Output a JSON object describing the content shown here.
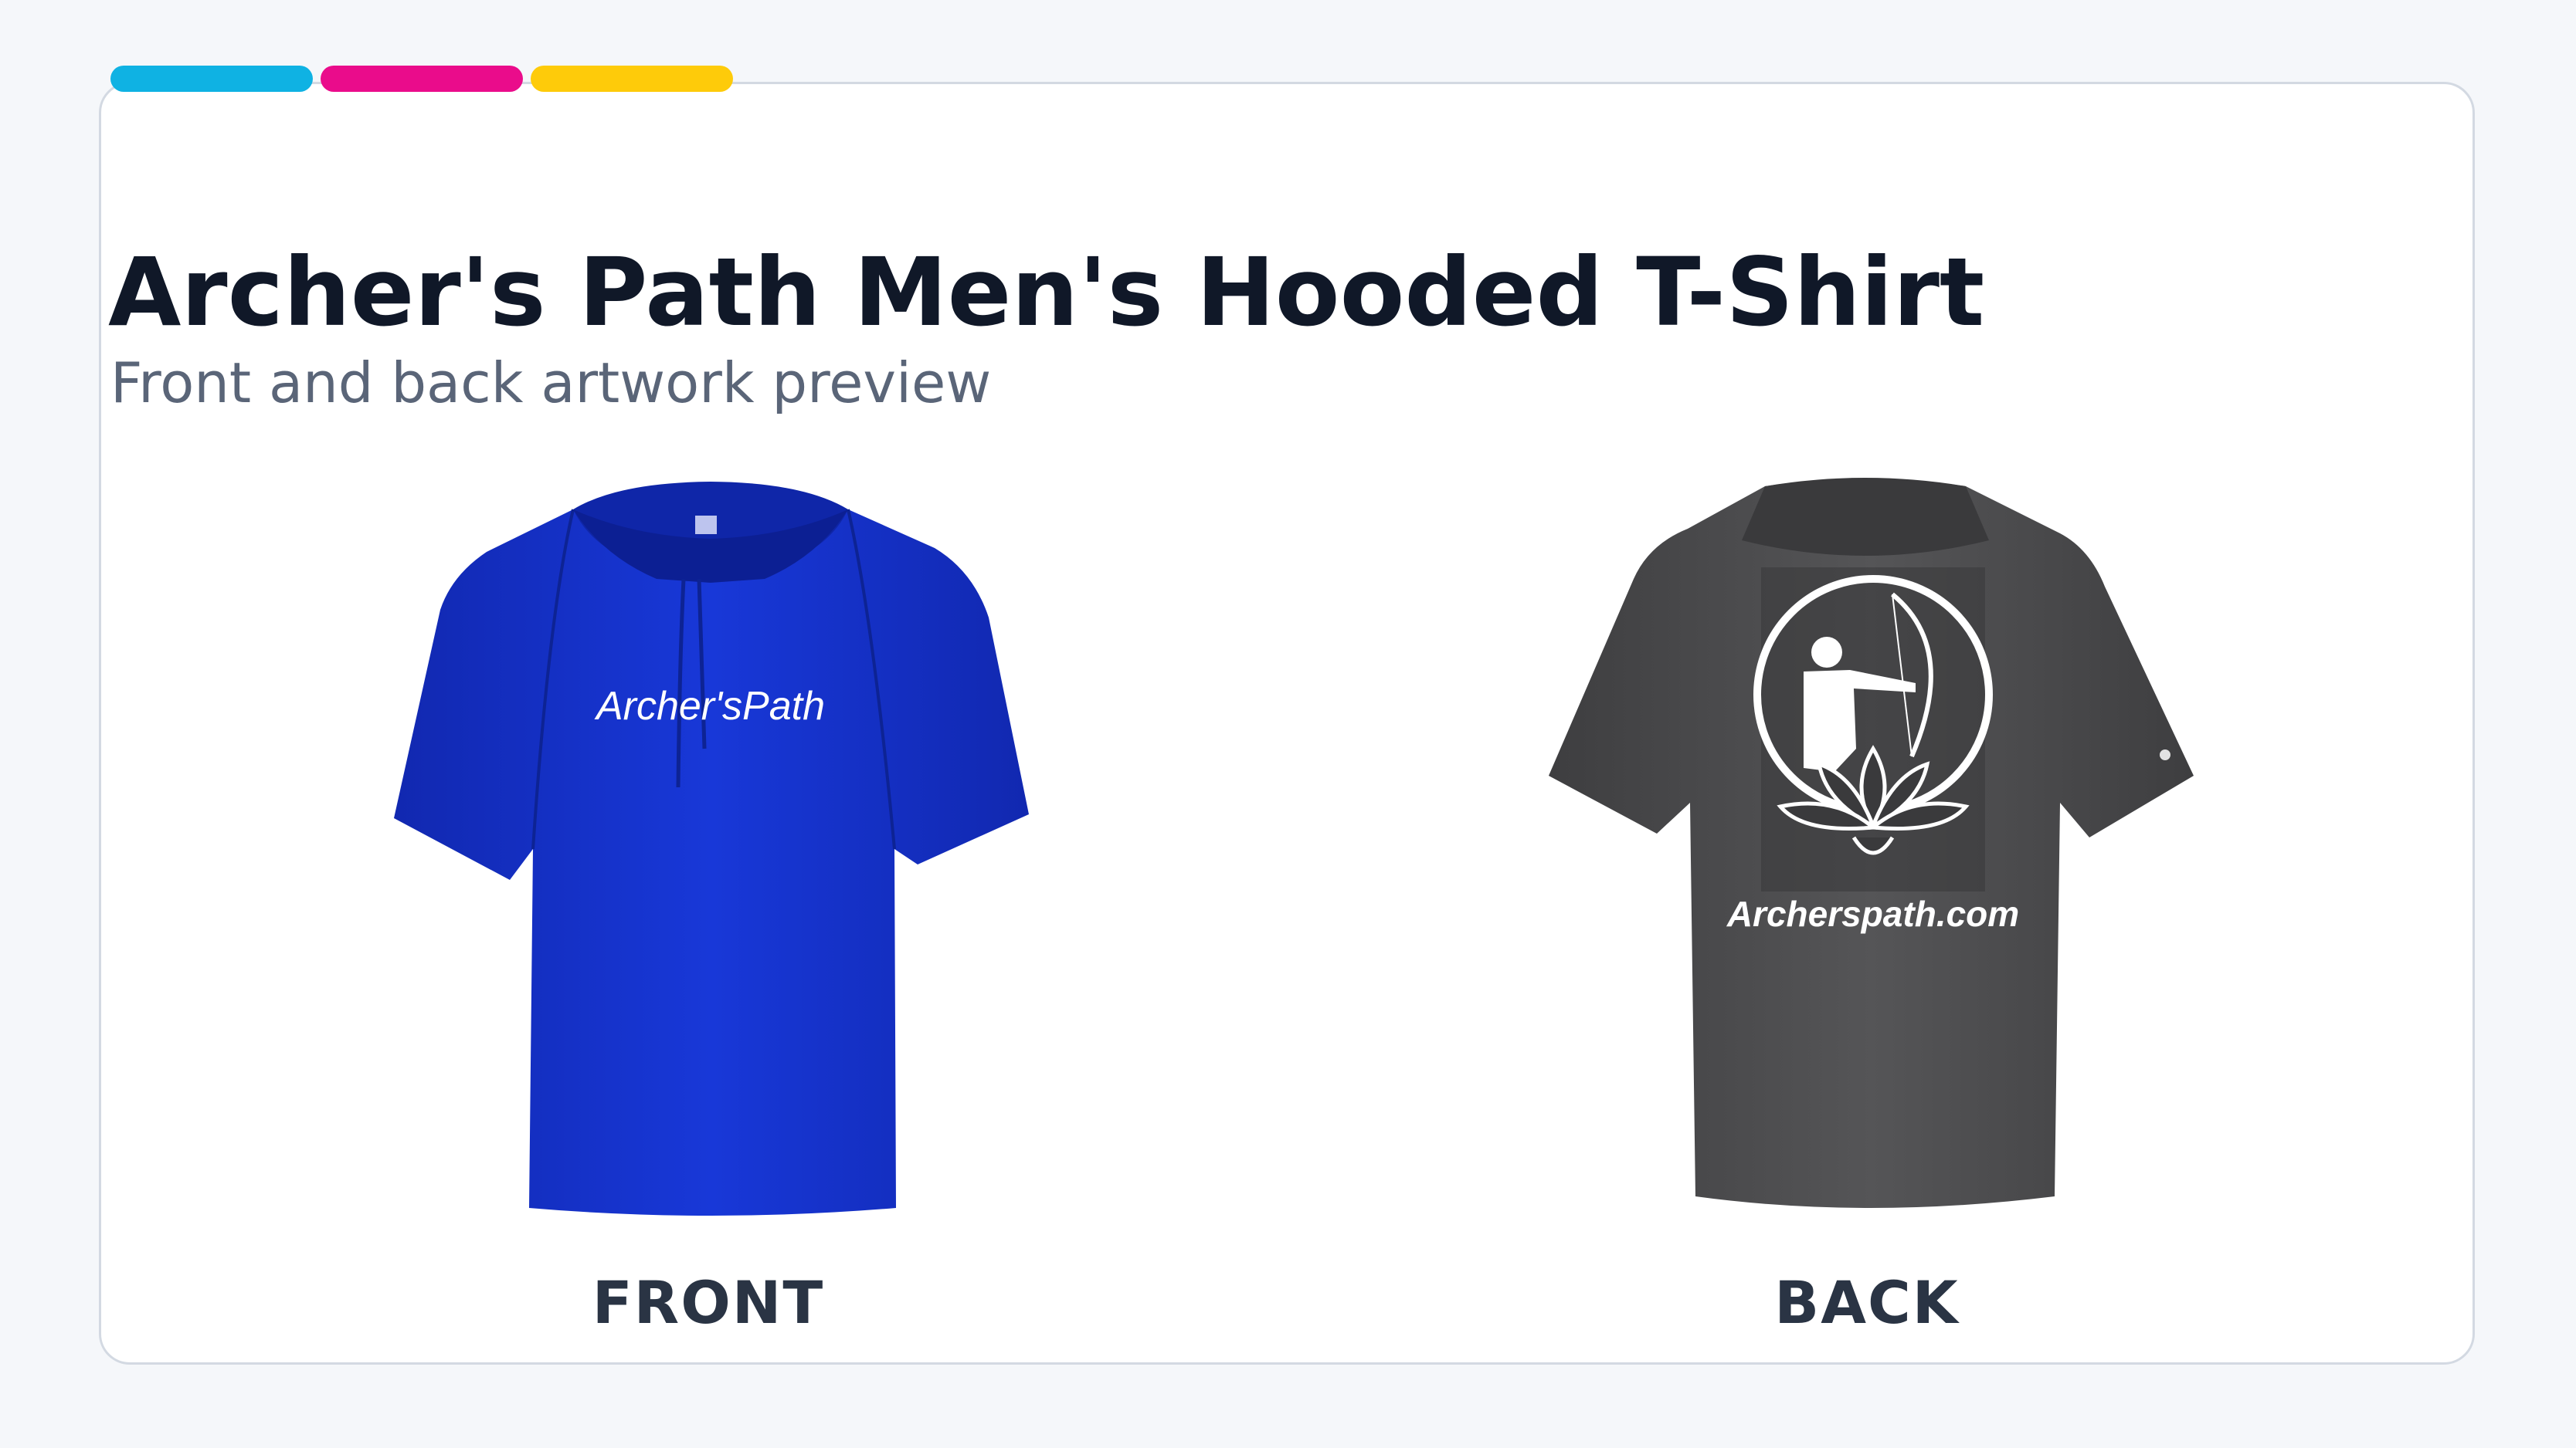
{
  "title": "Archer's Path Men's Hooded T-Shirt",
  "subtitle": "Front and back artwork preview",
  "accent_colors": [
    "#0fb2e3",
    "#ea0c8b",
    "#fecb0a"
  ],
  "front": {
    "caption": "FRONT",
    "shirt_color": "#1532c8",
    "print_text": "Archer'sPath"
  },
  "back": {
    "caption": "BACK",
    "shirt_color": "#4a4a4c",
    "print_text": "Archerspath.com",
    "print_graphic": "archer-lotus-logo"
  }
}
